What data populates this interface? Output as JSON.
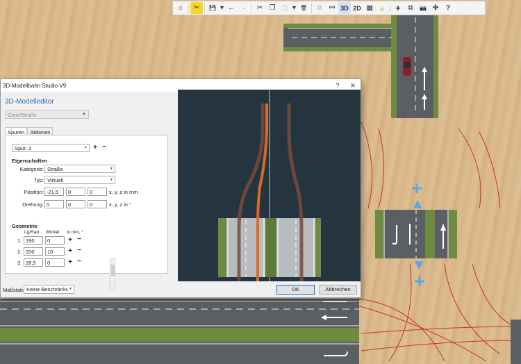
{
  "toolbar": {
    "buttons": [
      {
        "id": "home",
        "icon": "home-icon",
        "glyph": "⌂"
      },
      {
        "id": "tools",
        "icon": "tools-icon",
        "glyph": "✂",
        "active": true
      },
      {
        "id": "save",
        "icon": "save-icon",
        "glyph": "💾"
      },
      {
        "id": "save-menu",
        "icon": "chevron-down-icon",
        "glyph": "▾"
      },
      {
        "id": "undo",
        "icon": "undo-icon",
        "glyph": "←"
      },
      {
        "id": "redo",
        "icon": "redo-icon",
        "glyph": "→",
        "disabled": true
      },
      {
        "id": "cut",
        "icon": "cut-icon",
        "glyph": "✂"
      },
      {
        "id": "copy",
        "icon": "copy-icon",
        "glyph": "❐"
      },
      {
        "id": "paste",
        "icon": "paste-icon",
        "glyph": "📋",
        "disabled": true
      },
      {
        "id": "paste-menu",
        "icon": "chevron-down-icon",
        "glyph": "▾"
      },
      {
        "id": "delete",
        "icon": "trash-icon",
        "glyph": "🗑"
      },
      {
        "id": "group",
        "icon": "group-icon",
        "glyph": "⧉",
        "disabled": true
      },
      {
        "id": "link",
        "icon": "link-icon",
        "glyph": "⚯"
      },
      {
        "id": "view3d",
        "label": "3D",
        "selected": true
      },
      {
        "id": "view2d",
        "label": "2D"
      },
      {
        "id": "grid",
        "icon": "grid-icon",
        "glyph": "▦"
      },
      {
        "id": "lock",
        "icon": "lock-icon",
        "glyph": "🔒",
        "disabled": true
      },
      {
        "id": "add",
        "icon": "plus-icon",
        "glyph": "+"
      },
      {
        "id": "layers",
        "icon": "layers-icon",
        "glyph": "⧉"
      },
      {
        "id": "camera",
        "icon": "camera-icon",
        "glyph": "📷"
      },
      {
        "id": "puzzle",
        "icon": "puzzle-icon",
        "glyph": "✤"
      },
      {
        "id": "help",
        "icon": "help-icon",
        "glyph": "?"
      }
    ]
  },
  "dialog": {
    "title": "3D-Modellbahn Studio V9",
    "title_buttons": {
      "help": "?",
      "close": "✕"
    },
    "heading": "3D-Modelleditor",
    "type_combo": "Gleis/Straße",
    "tabs": [
      "Spuren",
      "Aktionen"
    ],
    "lane_combo": "Spur: 2",
    "properties": {
      "section": "Eigenschaften",
      "category_label": "Kategorie:",
      "category_value": "Straße",
      "type_label": "Typ:",
      "type_value": "Virtuell",
      "position_label": "Position:",
      "position": [
        "-21,5",
        "0",
        "0"
      ],
      "position_unit": "x, y, z in mm",
      "rotation_label": "Drehung:",
      "rotation": [
        "0",
        "0",
        "0"
      ],
      "rotation_unit": "x, y, z in °"
    },
    "geometry": {
      "section": "Geometrie",
      "col_length": "Lg/Rad",
      "col_angle": "Winkel",
      "col_unit": "in mm, °",
      "rows": [
        {
          "num": "1.",
          "length": "190",
          "angle": "0"
        },
        {
          "num": "2.",
          "length": "200",
          "angle": "10"
        },
        {
          "num": "3.",
          "length": "28,5",
          "angle": "0"
        }
      ]
    },
    "footer": {
      "scale_label": "Maßstab:",
      "scale_value": "Keine Beschränkung",
      "ok": "OK",
      "cancel": "Abbrechen"
    }
  }
}
